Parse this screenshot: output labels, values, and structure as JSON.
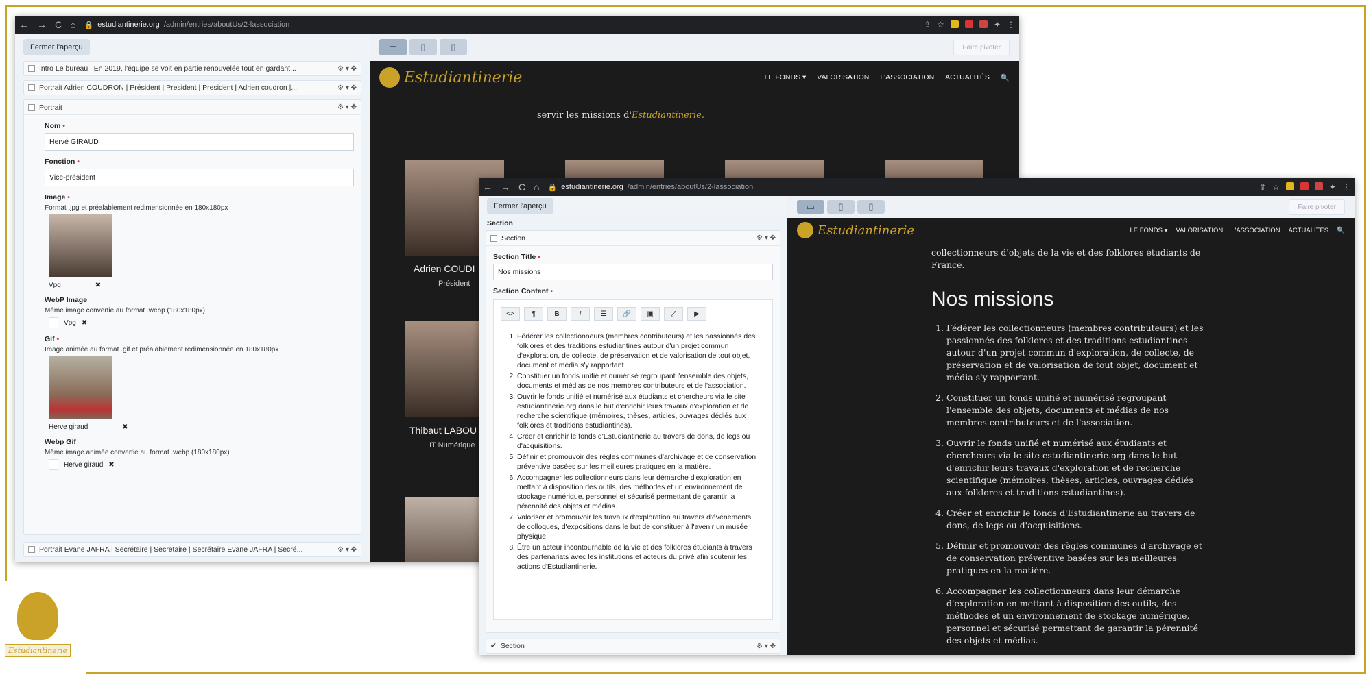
{
  "browser": {
    "url_domain": "estudiantinerie.org",
    "url_path": "/admin/entries/aboutUs/2-lassociation"
  },
  "admin1": {
    "close_preview": "Fermer l'aperçu",
    "rows_top": [
      "Intro   Le bureau | En 2019, l'équipe se voit en partie renouvelée tout en gardant...",
      "Portrait   Adrien COUDRON | Président | President | President | Adrien coudron |..."
    ],
    "panel_title": "Portrait",
    "nom_label": "Nom",
    "nom_value": "Hervé GIRAUD",
    "fonction_label": "Fonction",
    "fonction_value": "Vice-président",
    "image_label": "Image",
    "image_help": "Format .jpg et préalablement redimensionnée en 180x180px",
    "image_file": "Vpg",
    "webp_label": "WebP Image",
    "webp_help": "Même image convertie au format .webp (180x180px)",
    "webp_file": "Vpg",
    "gif_label": "Gif",
    "gif_help": "Image animée au format .gif et préalablement redimensionnée en 180x180px",
    "gif_file": "Herve giraud",
    "webpgif_label": "Webp Gif",
    "webpgif_help": "Même image animée convertie au format .webp (180x180px)",
    "webpgif_file": "Herve giraud",
    "row_bottom": "Portrait   Evane JAFRA | Secrétaire | Secretaire | Secrétaire Evane JAFRA | Secré..."
  },
  "preview_toolbar": {
    "pivot": "Faire pivoter"
  },
  "site": {
    "brand": "Estudiantinerie",
    "menu": [
      "LE FONDS ▾",
      "VALORISATION",
      "L'ASSOCIATION",
      "ACTUALITÉS"
    ],
    "intro_line": "servir les missions d'",
    "intro_brand": "Estudiantinerie.",
    "people": [
      {
        "name": "Adrien COUDI",
        "role": "Président"
      },
      {
        "name": "Thibaut LABOU",
        "role": "IT Numérique"
      }
    ]
  },
  "admin2": {
    "close_preview": "Fermer l'aperçu",
    "section_label": "Section",
    "section_row": "Section",
    "title_label": "Section Title",
    "title_value": "Nos missions",
    "content_label": "Section Content",
    "tools": [
      "<>",
      "¶",
      "B",
      "I",
      "☰",
      "🔗",
      "▣",
      "⤢",
      "▶"
    ],
    "items": [
      "Fédérer les collectionneurs (membres contributeurs) et les passionnés des folklores et des traditions estudiantines autour d'un projet commun d'exploration, de collecte, de préservation et de valorisation de tout objet, document et média s'y rapportant.",
      "Constituer un fonds unifié et numérisé regroupant l'ensemble des objets, documents et médias de nos membres contributeurs et de l'association.",
      "Ouvrir le fonds unifié et numérisé aux étudiants et chercheurs via le site estudiantinerie.org dans le but d'enrichir leurs travaux d'exploration et de recherche scientifique (mémoires, thèses, articles, ouvrages dédiés aux folklores et traditions estudiantines).",
      "Créer et enrichir le fonds d'Estudiantinerie au travers de dons, de legs ou d'acquisitions.",
      "Définir et promouvoir des règles communes d'archivage et de conservation préventive basées sur les meilleures pratiques en la matière.",
      "Accompagner les collectionneurs dans leur démarche d'exploration en mettant à disposition des outils, des méthodes et un environnement de stockage numérique, personnel et sécurisé permettant de garantir la pérennité des objets et médias.",
      "Valoriser et promouvoir les travaux d'exploration au travers d'événements, de colloques, d'expositions dans le but de constituer à l'avenir un musée physique.",
      "Être un acteur incontournable de la vie et des folklores étudiants à travers des partenariats avec les institutions et acteurs du privé afin soutenir les actions d'Estudiantinerie."
    ],
    "section_bottom": "Section"
  },
  "site2": {
    "intro": "collectionneurs d'objets de la vie et des folklores étudiants de France.",
    "heading": "Nos missions",
    "items": [
      "Fédérer les collectionneurs (membres contributeurs) et les passionnés des folklores et des traditions estudiantines autour d'un projet commun d'exploration, de collecte, de préservation et de valorisation de tout objet, document et média s'y rapportant.",
      "Constituer un fonds unifié et numérisé regroupant l'ensemble des objets, documents et médias de nos membres contributeurs et de l'association.",
      "Ouvrir le fonds unifié et numérisé aux étudiants et chercheurs via le site estudiantinerie.org dans le but d'enrichir leurs travaux d'exploration et de recherche scientifique (mémoires, thèses, articles, ouvrages dédiés aux folklores et traditions estudiantines).",
      "Créer et enrichir le fonds d'Estudiantinerie au travers de dons, de legs ou d'acquisitions.",
      "Définir et promouvoir des règles communes d'archivage et de conservation préventive basées sur les meilleures pratiques en la matière.",
      "Accompagner les collectionneurs dans leur démarche d'exploration en mettant à disposition des outils, des méthodes et un environnement de stockage numérique, personnel et sécurisé permettant de garantir la pérennité des objets et médias."
    ]
  },
  "corner": {
    "brand": "Estudiantinerie"
  },
  "colors": {
    "gold": "#c9a227",
    "dark": "#1b1b1b"
  }
}
